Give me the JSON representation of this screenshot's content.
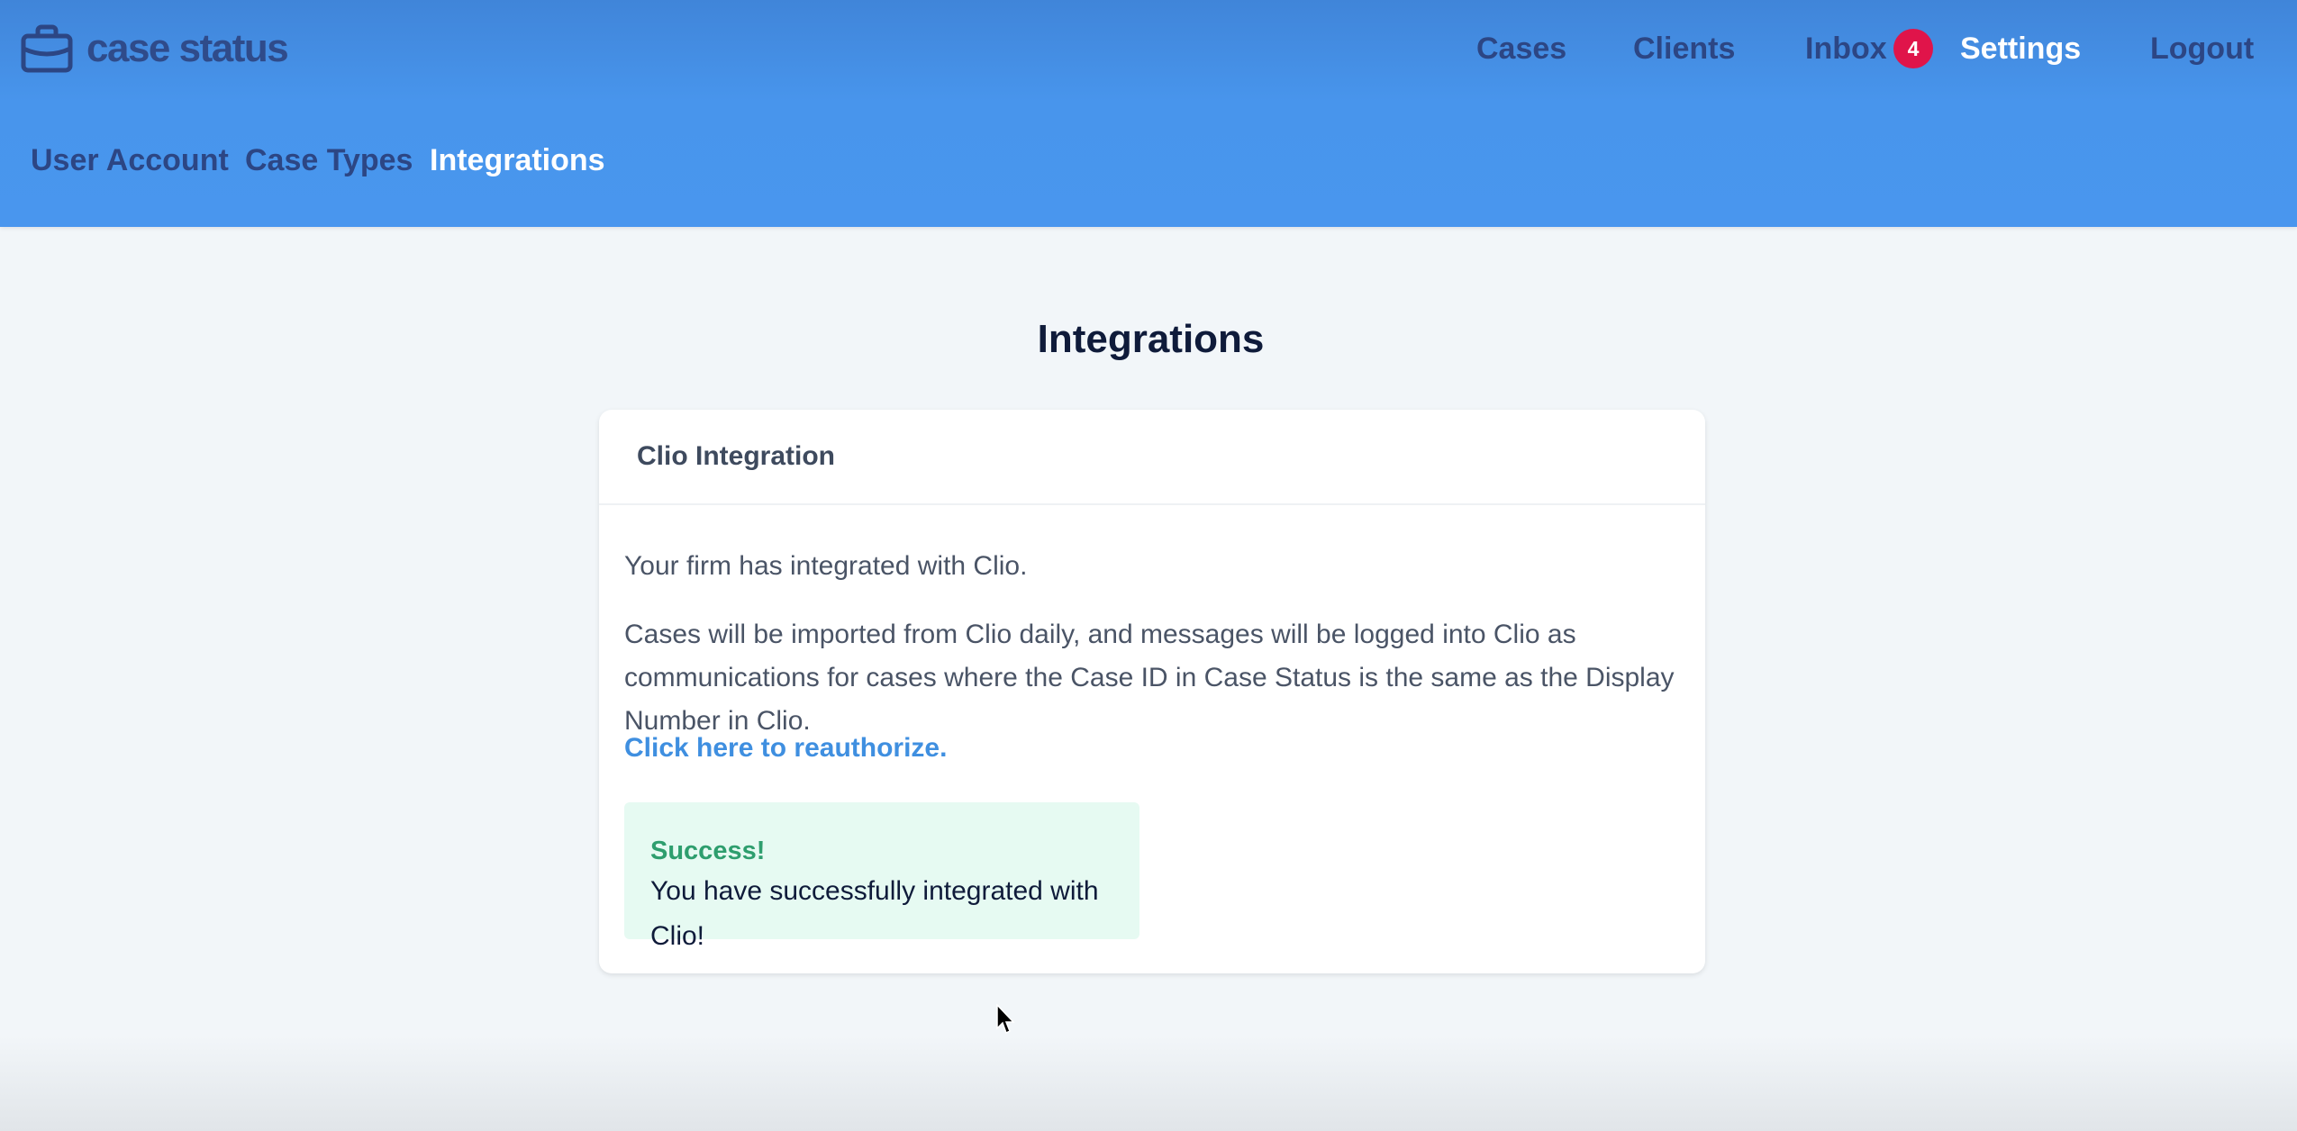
{
  "app": {
    "logo_text": "case status",
    "logo_icon": "briefcase-icon"
  },
  "top_nav": {
    "items": [
      {
        "label": "Cases"
      },
      {
        "label": "Clients"
      },
      {
        "label": "Inbox",
        "badge": "4"
      },
      {
        "label": "Settings",
        "active": true
      },
      {
        "label": "Logout"
      }
    ]
  },
  "sub_nav": {
    "items": [
      {
        "label": "User Account"
      },
      {
        "label": "Case Types"
      },
      {
        "label": "Integrations",
        "active": true
      }
    ]
  },
  "main": {
    "title": "Integrations",
    "card": {
      "title": "Clio Integration",
      "paragraph_1": "Your firm has integrated with Clio.",
      "paragraph_2": "Cases will be imported from Clio daily, and messages will be logged into Clio as communications for cases where the Case ID in Case Status is the same as the Display Number in Clio.",
      "reauthorize_link": "Click here to reauthorize.",
      "alert": {
        "title": "Success!",
        "text": "You have successfully integrated with Clio!"
      }
    }
  },
  "colors": {
    "header_blue": "#4996ee",
    "nav_text": "#2c4684",
    "active_nav": "#ffffff",
    "badge": "#e0144a",
    "link": "#3f8fe0",
    "success_bg": "#e6faf2",
    "success_title": "#2e9e6e"
  }
}
